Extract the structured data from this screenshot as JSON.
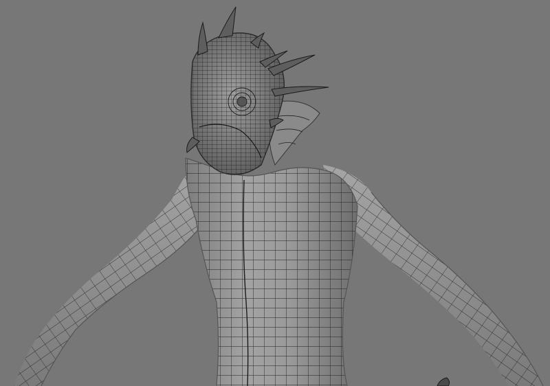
{
  "viewport": {
    "background_color": "#777777",
    "mesh_fill_color": "#9b9b9b",
    "mesh_shadow_color": "#6a6a6a",
    "wire_color": "#1e1e1e",
    "model_name": "creature-model",
    "display_mode": "shaded-wireframe",
    "icons": [
      "head-spike-icon"
    ]
  }
}
